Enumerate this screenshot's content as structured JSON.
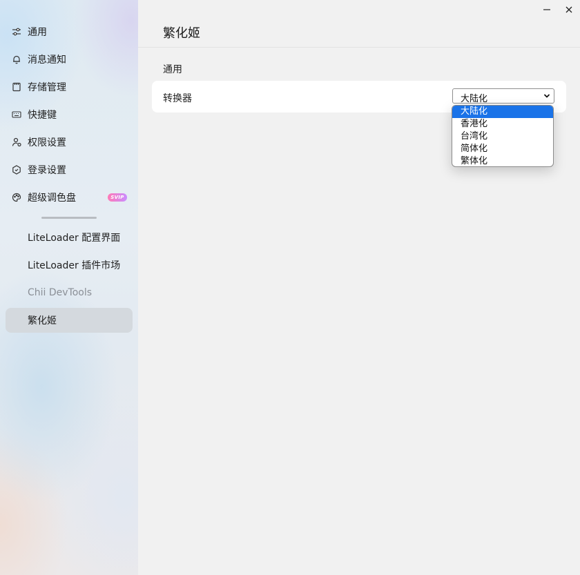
{
  "sidebar": {
    "items": [
      {
        "label": "通用",
        "icon": "sliders-icon"
      },
      {
        "label": "消息通知",
        "icon": "bell-icon"
      },
      {
        "label": "存储管理",
        "icon": "storage-icon"
      },
      {
        "label": "快捷键",
        "icon": "keyboard-icon"
      },
      {
        "label": "权限设置",
        "icon": "user-lock-icon"
      },
      {
        "label": "登录设置",
        "icon": "hexagon-icon"
      },
      {
        "label": "超级调色盘",
        "icon": "palette-icon",
        "badge": "SVIP"
      }
    ],
    "plugins": [
      {
        "label": "LiteLoader 配置界面"
      },
      {
        "label": "LiteLoader 插件市场"
      },
      {
        "label": "Chii DevTools"
      },
      {
        "label": "繁化姬"
      }
    ]
  },
  "main": {
    "title": "繁化姬",
    "section_title": "通用",
    "setting": {
      "label": "转换器",
      "selected": "大陆化",
      "options": [
        "大陆化",
        "香港化",
        "台湾化",
        "简体化",
        "繁体化"
      ]
    }
  },
  "colors": {
    "accent": "#1a73e8",
    "svip_gradient_start": "#ff7ab6",
    "svip_gradient_end": "#c98cff",
    "active_item_bg": "#d4d9de"
  }
}
